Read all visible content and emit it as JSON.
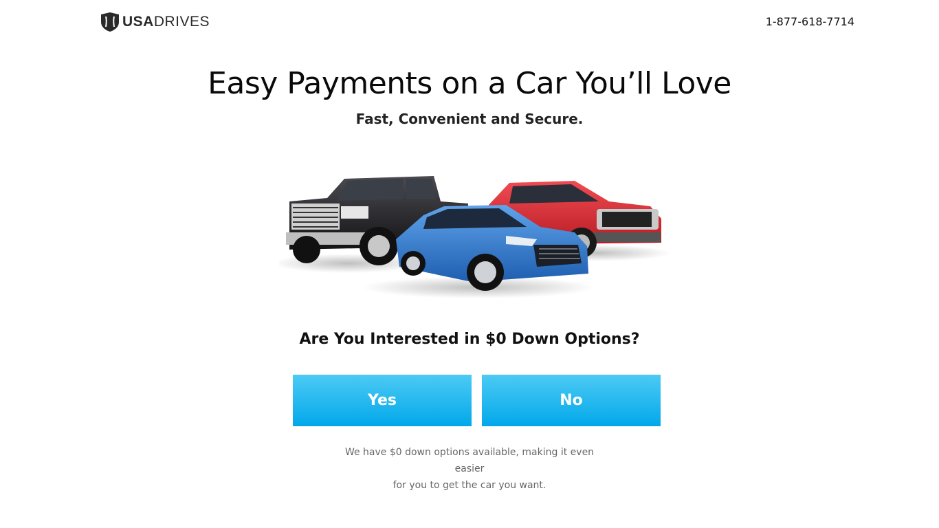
{
  "header": {
    "logo": {
      "text_bold": "USA",
      "text_regular": "DRIVES",
      "icon": "shield-icon"
    },
    "phone": "1-877-618-7714"
  },
  "hero": {
    "title": "Easy Payments on a Car You’ll Love",
    "subtitle": "Fast, Convenient and Secure.",
    "image_icon": "cars-image"
  },
  "question": {
    "text": "Are You Interested in $0 Down Options?",
    "yes_label": "Yes",
    "no_label": "No"
  },
  "note": {
    "line1": "We have $0 down options available, making it even easier",
    "line2": "for you to get the car you want."
  },
  "colors": {
    "button_top": "#4ccaf4",
    "button_bottom": "#02a8ea",
    "truck": "#1e1e22",
    "sedan": "#2f74c9",
    "suv": "#d8262f"
  }
}
